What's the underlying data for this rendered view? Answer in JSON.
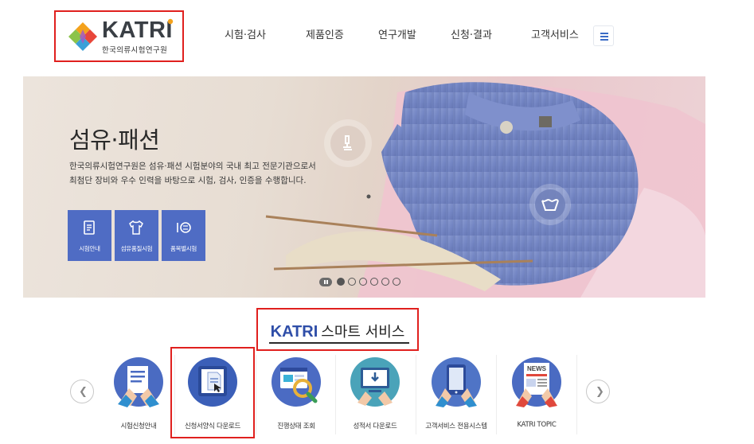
{
  "header": {
    "logo_text": "KATRI",
    "logo_sub": "한국의류시험연구원",
    "nav": [
      "시험·검사",
      "제품인증",
      "연구개발",
      "신청·결과",
      "고객서비스"
    ]
  },
  "hero": {
    "title": "섬유·패션",
    "desc_line1": "한국의류시험연구원은 섬유·패션 시험분야의 국내 최고 전문기관으로서",
    "desc_line2": "최첨단 장비와 우수 인력을 바탕으로 시험, 검사, 인증을 수행합니다.",
    "quick_buttons": [
      "시험안내",
      "섬유품질시험",
      "품목별시험"
    ],
    "slide_count": 6,
    "active_slide": 1
  },
  "smart_service": {
    "title_brand": "KATRI",
    "title_text": "스마트 서비스",
    "items": [
      "시험신청안내",
      "신청서양식 다운로드",
      "진행상태 조회",
      "성적서 다운로드",
      "고객서비스 전용시스템",
      "KATRI TOPIC"
    ]
  },
  "colors": {
    "accent_blue": "#4f6cc4",
    "brand_blue": "#2f4ea8",
    "highlight_red": "#e0201e"
  }
}
